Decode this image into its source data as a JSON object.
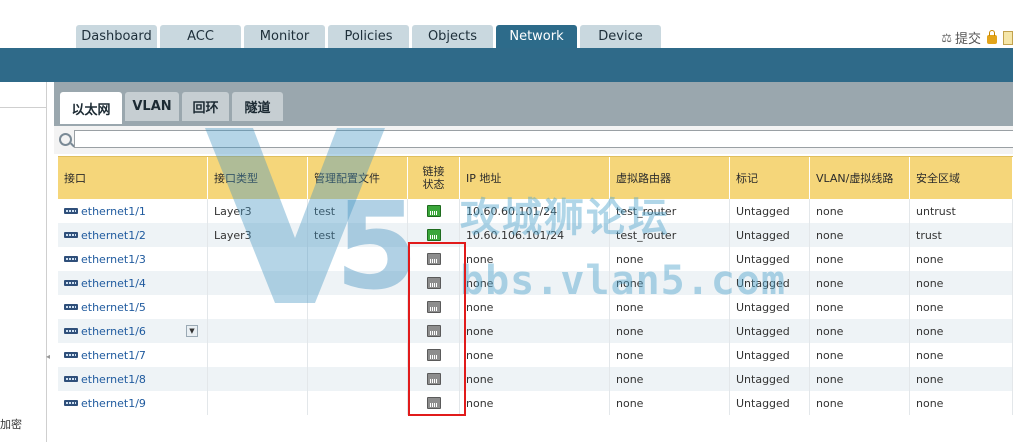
{
  "top_tabs": [
    {
      "label": "Dashboard",
      "active": false
    },
    {
      "label": "ACC",
      "active": false
    },
    {
      "label": "Monitor",
      "active": false
    },
    {
      "label": "Policies",
      "active": false
    },
    {
      "label": "Objects",
      "active": false
    },
    {
      "label": "Network",
      "active": true
    },
    {
      "label": "Device",
      "active": false
    }
  ],
  "top_actions": {
    "commit_label": "提交"
  },
  "sidebar": {
    "partial_label": "加密"
  },
  "sub_tabs": [
    {
      "label": "以太网",
      "active": true
    },
    {
      "label": "VLAN",
      "active": false
    },
    {
      "label": "回环",
      "active": false
    },
    {
      "label": "隧道",
      "active": false
    }
  ],
  "search": {
    "value": ""
  },
  "table": {
    "columns": [
      "接口",
      "接口类型",
      "管理配置文件",
      "链接状态",
      "IP 地址",
      "虚拟路由器",
      "标记",
      "VLAN/虚拟线路",
      "安全区域"
    ],
    "rows": [
      {
        "interface": "ethernet1/1",
        "type": "Layer3",
        "profile": "test",
        "link": "up",
        "ip": "10.60.60.101/24",
        "router": "test_router",
        "tag": "Untagged",
        "vlan": "none",
        "zone": "untrust"
      },
      {
        "interface": "ethernet1/2",
        "type": "Layer3",
        "profile": "test",
        "link": "up",
        "ip": "10.60.106.101/24",
        "router": "test_router",
        "tag": "Untagged",
        "vlan": "none",
        "zone": "trust"
      },
      {
        "interface": "ethernet1/3",
        "type": "",
        "profile": "",
        "link": "down",
        "ip": "none",
        "router": "none",
        "tag": "Untagged",
        "vlan": "none",
        "zone": "none"
      },
      {
        "interface": "ethernet1/4",
        "type": "",
        "profile": "",
        "link": "down",
        "ip": "none",
        "router": "none",
        "tag": "Untagged",
        "vlan": "none",
        "zone": "none"
      },
      {
        "interface": "ethernet1/5",
        "type": "",
        "profile": "",
        "link": "down",
        "ip": "none",
        "router": "none",
        "tag": "Untagged",
        "vlan": "none",
        "zone": "none"
      },
      {
        "interface": "ethernet1/6",
        "type": "",
        "profile": "",
        "link": "down",
        "ip": "none",
        "router": "none",
        "tag": "Untagged",
        "vlan": "none",
        "zone": "none"
      },
      {
        "interface": "ethernet1/7",
        "type": "",
        "profile": "",
        "link": "down",
        "ip": "none",
        "router": "none",
        "tag": "Untagged",
        "vlan": "none",
        "zone": "none"
      },
      {
        "interface": "ethernet1/8",
        "type": "",
        "profile": "",
        "link": "down",
        "ip": "none",
        "router": "none",
        "tag": "Untagged",
        "vlan": "none",
        "zone": "none"
      },
      {
        "interface": "ethernet1/9",
        "type": "",
        "profile": "",
        "link": "down",
        "ip": "none",
        "router": "none",
        "tag": "Untagged",
        "vlan": "none",
        "zone": "none"
      }
    ]
  },
  "watermark": {
    "title": "攻城狮论坛",
    "url": "bbs.vlan5.com"
  },
  "colors": {
    "header_blue": "#2f6a89",
    "table_header": "#f5d67a",
    "link_up": "#3aa63a",
    "link_down": "#8d8d8d",
    "highlight": "#e11b1b"
  }
}
